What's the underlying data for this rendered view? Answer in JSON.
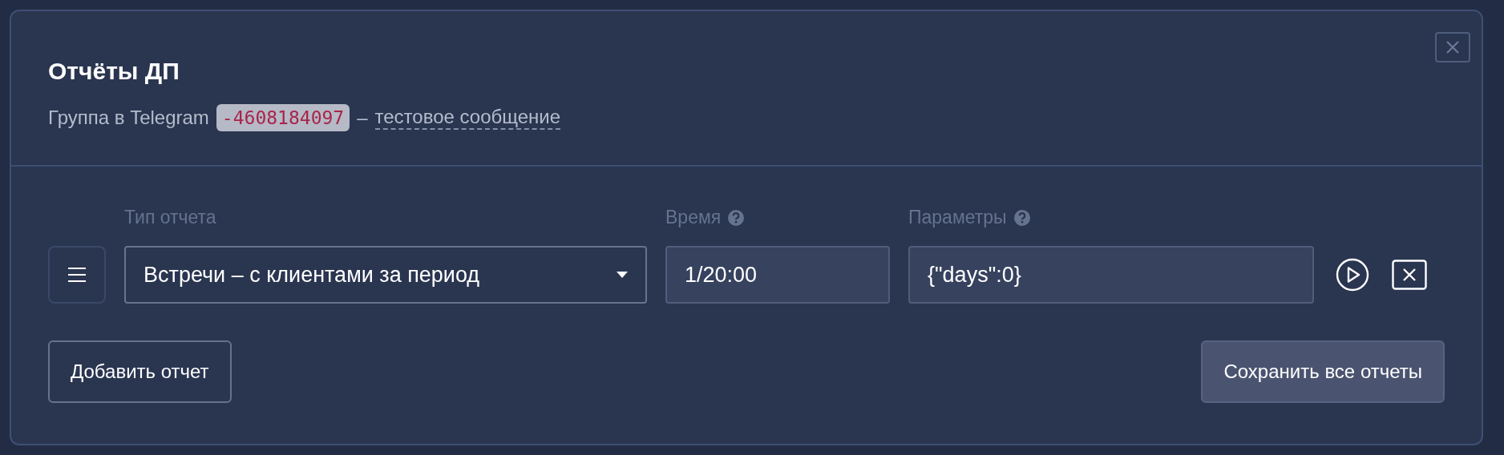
{
  "title": "Отчёты ДП",
  "subtitle": {
    "prefix": "Группа в Telegram",
    "code": "-4608184097",
    "dash": "–",
    "link": "тестовое сообщение"
  },
  "columns": [
    {
      "label": "Тип отчета",
      "help": false
    },
    {
      "label": "Время",
      "help": true
    },
    {
      "label": "Параметры",
      "help": true
    }
  ],
  "rows": [
    {
      "report_type": "Встречи – с клиентами за период",
      "time": "1/20:00",
      "params": "{\"days\":0}"
    }
  ],
  "buttons": {
    "add": "Добавить отчет",
    "save": "Сохранить все отчеты"
  }
}
